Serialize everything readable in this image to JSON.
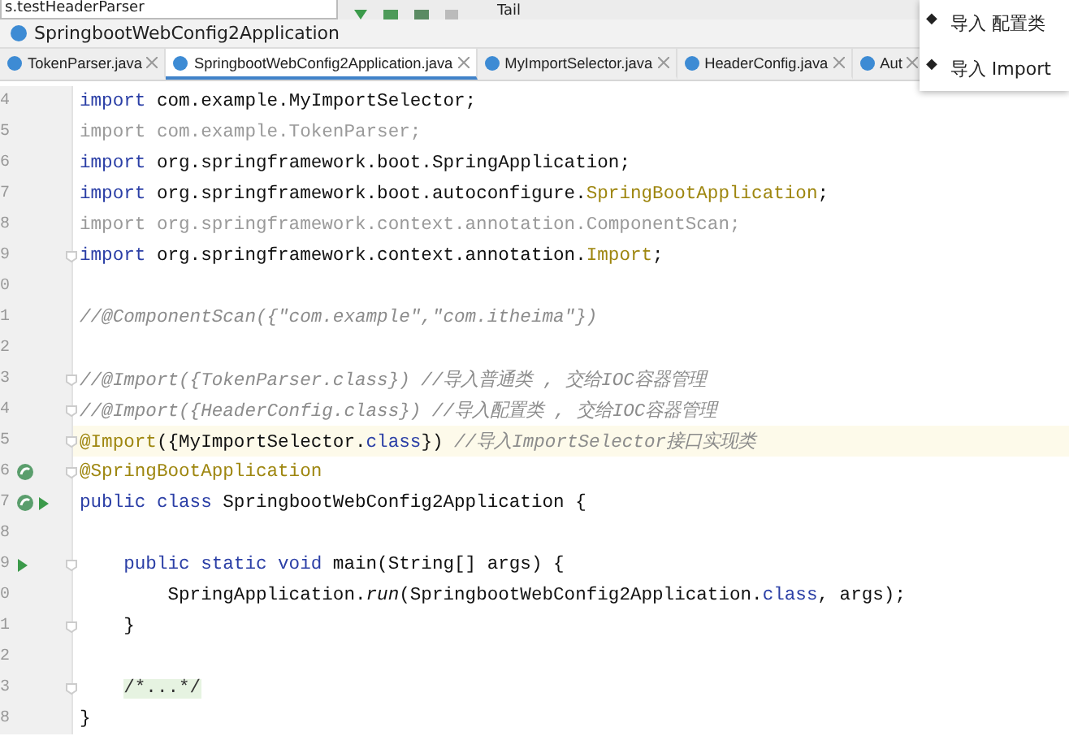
{
  "toolbar": {
    "run_config": "s.testHeaderParser",
    "tail_label": "Tail"
  },
  "breadcrumb": "SpringbootWebConfig2Application",
  "tabs": [
    {
      "label": "TokenParser.java",
      "selected": false
    },
    {
      "label": "SpringbootWebConfig2Application.java",
      "selected": true
    },
    {
      "label": "MyImportSelector.java",
      "selected": false
    },
    {
      "label": "HeaderConfig.java",
      "selected": false
    },
    {
      "label": "Aut",
      "selected": false
    }
  ],
  "popup_menu": [
    {
      "bullet": "◆",
      "label": "导入 配置类"
    },
    {
      "bullet": "◆",
      "label": "导入 Import"
    }
  ],
  "editor": {
    "lines": [
      {
        "number": "4",
        "segments": [
          {
            "kind": "kw",
            "text": "import"
          },
          {
            "kind": "plain",
            "text": " com.example.MyImportSelector;"
          }
        ]
      },
      {
        "number": "5",
        "segments": [
          {
            "kind": "unused",
            "text": "import com.example.TokenParser;"
          }
        ]
      },
      {
        "number": "6",
        "segments": [
          {
            "kind": "kw",
            "text": "import"
          },
          {
            "kind": "plain",
            "text": " org.springframework.boot.SpringApplication;"
          }
        ]
      },
      {
        "number": "7",
        "segments": [
          {
            "kind": "kw",
            "text": "import"
          },
          {
            "kind": "plain",
            "text": " org.springframework.boot.autoconfigure."
          },
          {
            "kind": "ann",
            "text": "SpringBootApplication"
          },
          {
            "kind": "plain",
            "text": ";"
          }
        ]
      },
      {
        "number": "8",
        "segments": [
          {
            "kind": "unused",
            "text": "import org.springframework.context.annotation.ComponentScan;"
          }
        ]
      },
      {
        "number": "9",
        "fold": true,
        "segments": [
          {
            "kind": "kw",
            "text": "import"
          },
          {
            "kind": "plain",
            "text": " org.springframework.context.annotation."
          },
          {
            "kind": "ann",
            "text": "Import"
          },
          {
            "kind": "plain",
            "text": ";"
          }
        ]
      },
      {
        "number": "0"
      },
      {
        "number": "1",
        "segments": [
          {
            "kind": "comment",
            "text": "//@ComponentScan({\"com.example\",\"com.itheima\"})"
          }
        ]
      },
      {
        "number": "2"
      },
      {
        "number": "3",
        "fold": true,
        "segments": [
          {
            "kind": "comment",
            "text": "//@Import({TokenParser.class}) //导入普通类 , 交给IOC容器管理"
          }
        ]
      },
      {
        "number": "4",
        "fold": true,
        "segments": [
          {
            "kind": "comment",
            "text": "//@Import({HeaderConfig.class}) //导入配置类 , 交给IOC容器管理"
          }
        ]
      },
      {
        "number": "5",
        "fold": true,
        "current": true,
        "segments": [
          {
            "kind": "ann",
            "text": "@Import"
          },
          {
            "kind": "plain",
            "text": "({MyImportSelector."
          },
          {
            "kind": "kw",
            "text": "class"
          },
          {
            "kind": "plain",
            "text": "}) "
          },
          {
            "kind": "comment",
            "text": "//导入ImportSelector接口实现类"
          }
        ]
      },
      {
        "number": "6",
        "fold": true,
        "bean": true,
        "segments": [
          {
            "kind": "ann",
            "text": "@SpringBootApplication"
          }
        ]
      },
      {
        "number": "7",
        "bean": true,
        "run": true,
        "segments": [
          {
            "kind": "kw",
            "text": "public class"
          },
          {
            "kind": "plain",
            "text": " SpringbootWebConfig2Application {"
          }
        ]
      },
      {
        "number": "8"
      },
      {
        "number": "9",
        "run": true,
        "fold": true,
        "segments": [
          {
            "kind": "kw",
            "text": "    public static void"
          },
          {
            "kind": "plain",
            "text": " main(String[] args) {"
          }
        ]
      },
      {
        "number": "0",
        "segments": [
          {
            "kind": "plain",
            "text": "        SpringApplication."
          },
          {
            "kind": "italic",
            "text": "run"
          },
          {
            "kind": "plain",
            "text": "(SpringbootWebConfig2Application."
          },
          {
            "kind": "kw",
            "text": "class"
          },
          {
            "kind": "plain",
            "text": ", args);"
          }
        ]
      },
      {
        "number": "1",
        "fold": true,
        "segments": [
          {
            "kind": "plain",
            "text": "    }"
          }
        ]
      },
      {
        "number": "2"
      },
      {
        "number": "3",
        "fold": true,
        "segments": [
          {
            "kind": "folded",
            "text": "/*...*/"
          }
        ]
      },
      {
        "number": "8",
        "segments": [
          {
            "kind": "plain",
            "text": "}"
          }
        ]
      }
    ]
  }
}
